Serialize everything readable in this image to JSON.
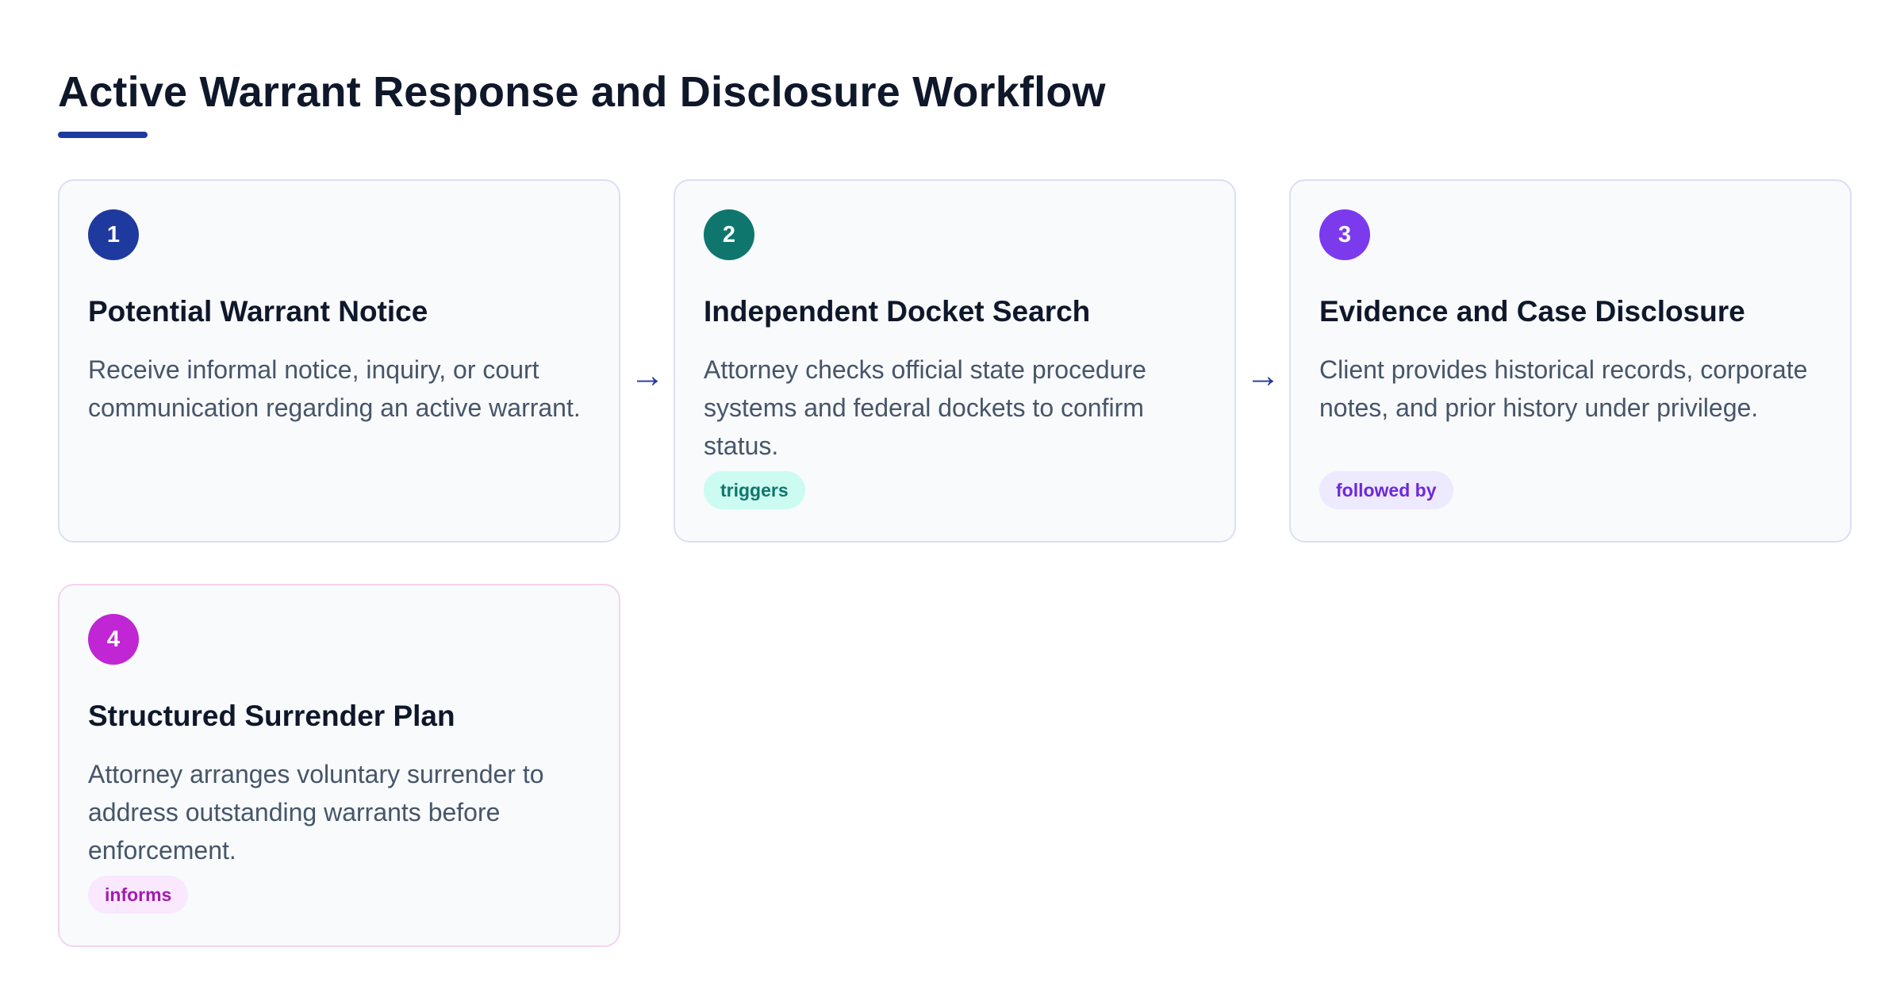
{
  "title": "Active Warrant Response and Disclosure Workflow",
  "colors": {
    "accent": "#1e3a9e"
  },
  "steps": [
    {
      "number": "1",
      "title": "Potential Warrant Notice",
      "description": "Receive informal notice, inquiry, or court communication regarding an active warrant.",
      "badge_color": "#1e3a9e",
      "tag": ""
    },
    {
      "number": "2",
      "title": "Independent Docket Search",
      "description": "Attorney checks official state procedure systems and federal dockets to confirm status.",
      "badge_color": "#0f766e",
      "tag": "triggers",
      "tag_bg": "#ccfbf1",
      "tag_color": "#0f766e"
    },
    {
      "number": "3",
      "title": "Evidence and Case Disclosure",
      "description": "Client provides historical records, corporate notes, and prior history under privilege.",
      "badge_color": "#7c3aed",
      "tag": "followed by",
      "tag_bg": "#ede9fe",
      "tag_color": "#6d28d9"
    },
    {
      "number": "4",
      "title": "Structured Surrender Plan",
      "description": "Attorney arranges voluntary surrender to address outstanding warrants before enforcement.",
      "badge_color": "#c026d3",
      "tag": "informs",
      "tag_bg": "#fae8ff",
      "tag_color": "#a21caf"
    }
  ],
  "arrows": [
    "→",
    "→"
  ]
}
